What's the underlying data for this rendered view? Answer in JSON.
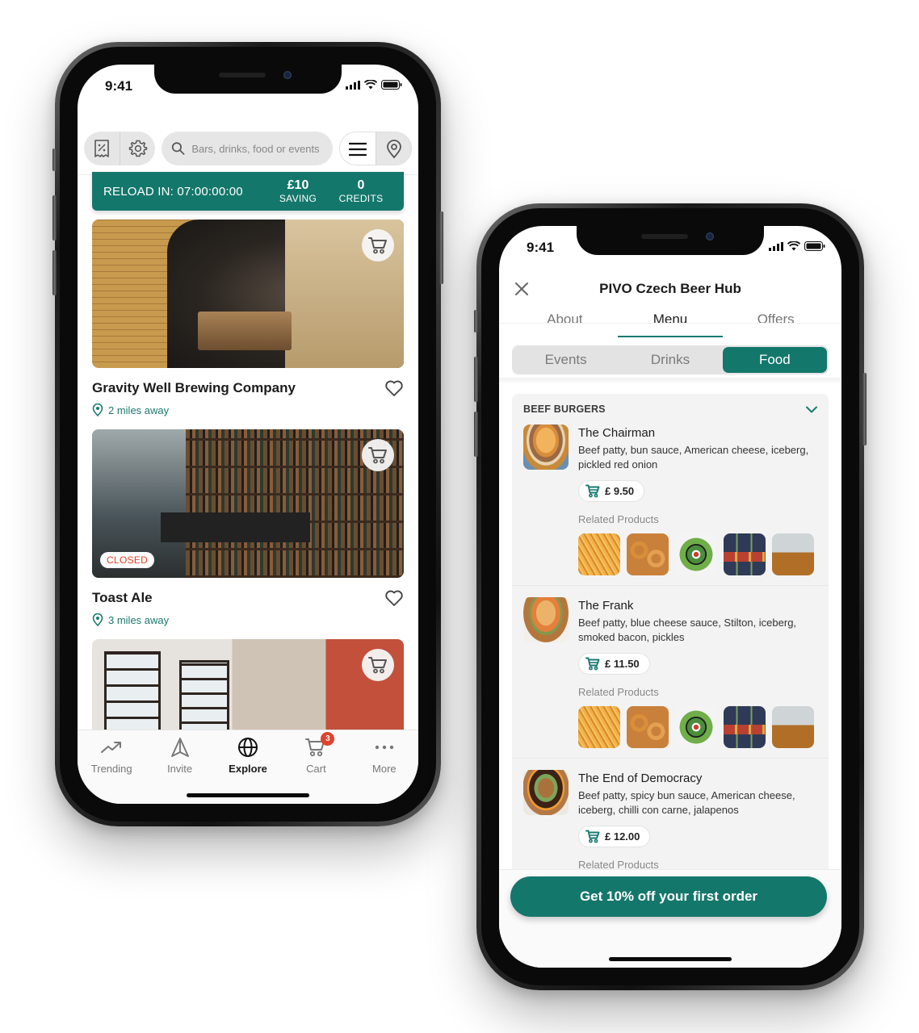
{
  "colors": {
    "brand": "#14776b",
    "accent_text": "#1a7a6f",
    "closed_red": "#e0432d",
    "badge_red": "#e0432d"
  },
  "status_bar": {
    "time": "9:41"
  },
  "explore_screen": {
    "toolbar": {
      "left_icons": [
        "receipt-discount-icon",
        "gear-icon"
      ],
      "search_placeholder": "Bars, drinks, food or events",
      "right_icons": [
        "list-menu-icon",
        "map-pin-icon"
      ]
    },
    "reload_banner": {
      "label": "RELOAD IN: 07:00:00:00",
      "saving_value": "£10",
      "saving_label": "SAVING",
      "credits_value": "0",
      "credits_label": "CREDITS"
    },
    "venues": [
      {
        "name": "Gravity Well Brewing Company",
        "distance": "2 miles away",
        "status": ""
      },
      {
        "name": "Toast Ale",
        "distance": "3 miles away",
        "status": "CLOSED"
      },
      {
        "name": "",
        "distance": "",
        "status": ""
      }
    ],
    "tabbar": [
      {
        "label": "Trending",
        "icon": "trending-up-icon",
        "active": false
      },
      {
        "label": "Invite",
        "icon": "send-icon",
        "active": false
      },
      {
        "label": "Explore",
        "icon": "globe-icon",
        "active": true
      },
      {
        "label": "Cart",
        "icon": "cart-icon",
        "active": false,
        "badge": "3"
      },
      {
        "label": "More",
        "icon": "more-horizontal-icon",
        "active": false
      }
    ]
  },
  "venue_screen": {
    "title": "PIVO Czech Beer Hub",
    "tabs": [
      {
        "label": "About",
        "active": false
      },
      {
        "label": "Menu",
        "active": true
      },
      {
        "label": "Offers",
        "active": false
      }
    ],
    "segments": [
      {
        "label": "Events",
        "active": false
      },
      {
        "label": "Drinks",
        "active": false
      },
      {
        "label": "Food",
        "active": true
      }
    ],
    "category": "BEEF BURGERS",
    "related_label": "Related Products",
    "related_products": [
      "fries",
      "onion-rings",
      "greek-salad",
      "beer-bottles",
      "beer-mug"
    ],
    "items": [
      {
        "name": "The Chairman",
        "description": "Beef patty, bun sauce, American cheese, iceberg, pickled red onion",
        "price": "£ 9.50"
      },
      {
        "name": "The Frank",
        "description": "Beef patty, blue cheese sauce, Stilton, iceberg, smoked bacon, pickles",
        "price": "£ 11.50"
      },
      {
        "name": "The End of Democracy",
        "description": "Beef patty, spicy bun sauce, American cheese, iceberg, chilli con carne, jalapenos",
        "price": "£ 12.00"
      }
    ],
    "cta_label": "Get 10% off your first order"
  }
}
